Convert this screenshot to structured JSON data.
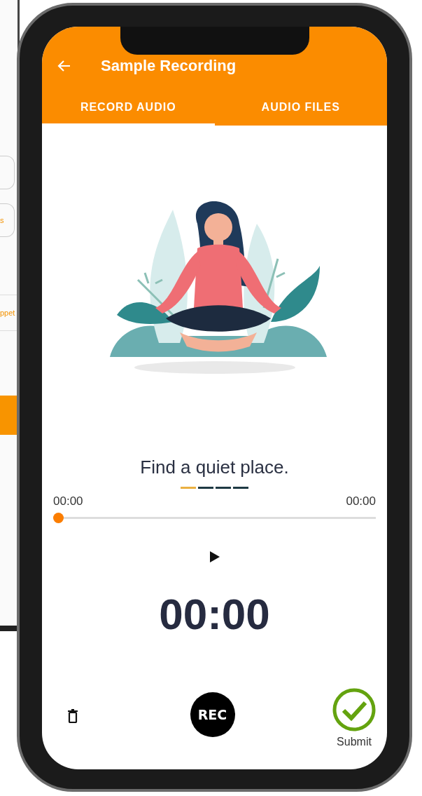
{
  "background_device": {
    "fragments": [
      {
        "kind": "button"
      },
      {
        "kind": "button",
        "text": "s"
      },
      {
        "kind": "row",
        "text": "ppet"
      },
      {
        "kind": "bar"
      }
    ]
  },
  "app_bar": {
    "title": "Sample Recording"
  },
  "tabs": [
    {
      "label": "RECORD AUDIO",
      "selected": true
    },
    {
      "label": "AUDIO FILES",
      "selected": false
    }
  ],
  "prompt": {
    "text": "Find a quiet place.",
    "steps": [
      {
        "selected": true
      },
      {
        "selected": false
      },
      {
        "selected": false
      },
      {
        "selected": false
      }
    ]
  },
  "player": {
    "elapsed": "00:00",
    "total": "00:00",
    "level": 0
  },
  "timer": "00:00",
  "controls": {
    "record_label": "REC",
    "submit_label": "Submit"
  }
}
